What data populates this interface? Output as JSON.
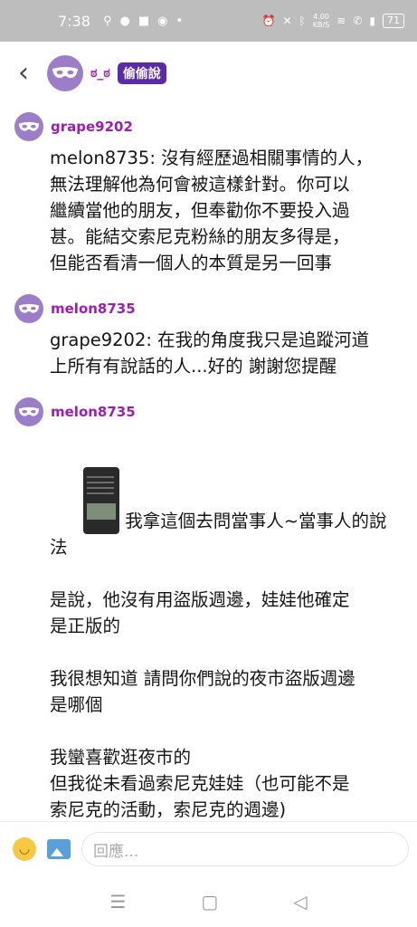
{
  "status": {
    "time": "7:38",
    "net_speed": "4.00",
    "net_unit": "KB/S",
    "battery": "71"
  },
  "header": {
    "board_name": "ಠ_ಠ",
    "board_tag": "偷偷說"
  },
  "comments": [
    {
      "user": "grape9202",
      "text": "melon8735: 沒有經歷過相關事情的人，\n無法理解他為何會被這樣針對。你可以\n繼續當他的朋友，但奉勸你不要投入過\n甚。能結交索尼克粉絲的朋友多得是，\n但能否看清一個人的本質是另一回事"
    },
    {
      "user": "melon8735",
      "text": "grape9202: 在我的角度我只是追蹤河道\n上所有有說話的人...好的 謝謝您提醒"
    },
    {
      "user": "melon8735",
      "first_line": "我拿這個去問當事人~當事人的說法",
      "text": "是說，他沒有用盜版週邊，娃娃他確定\n是正版的\n\n我很想知道 請問你們說的夜市盜版週邊\n是哪個\n\n我蠻喜歡逛夜市的\n但我從未看過索尼克娃娃（也可能不是\n索尼克的活動，索尼克的週邊)\n我不了解詳細狀況"
    }
  ],
  "composer": {
    "placeholder": "回應..."
  }
}
